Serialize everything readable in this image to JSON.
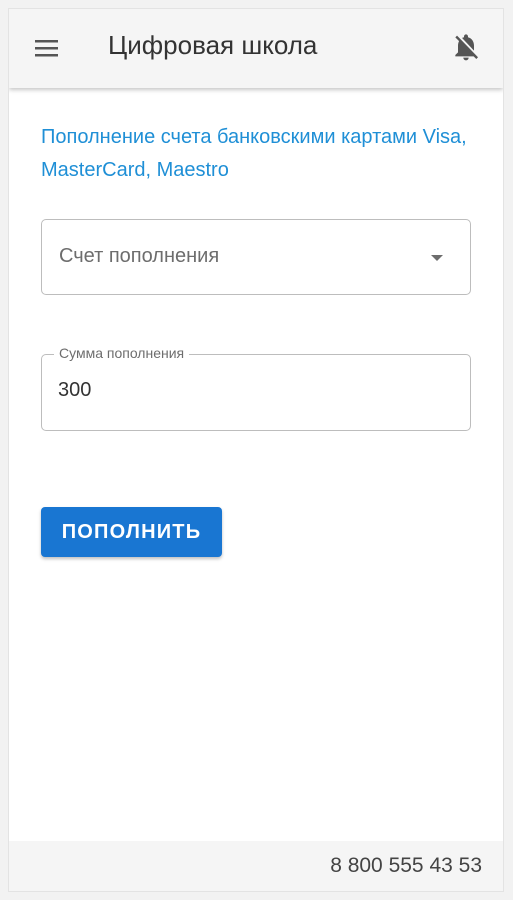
{
  "app_bar": {
    "title": "Цифровая школа",
    "menu_icon": "hamburger-menu-icon",
    "notifications_icon": "notifications-off-icon"
  },
  "main": {
    "intro_text": "Пополнение счета банковскими картами Visa, MasterCard, Maestro",
    "account_select": {
      "label": "Счет пополнения",
      "icon": "chevron-down-icon"
    },
    "amount_field": {
      "label": "Сумма пополнения",
      "value": "300"
    },
    "submit_button": {
      "label": "ПОПОЛНИТЬ"
    }
  },
  "footer": {
    "phone": "8 800 555 43 53"
  },
  "colors": {
    "accent_text": "#1f8fd6",
    "button_bg": "#1976d2",
    "app_bar_bg": "#f5f5f5"
  }
}
